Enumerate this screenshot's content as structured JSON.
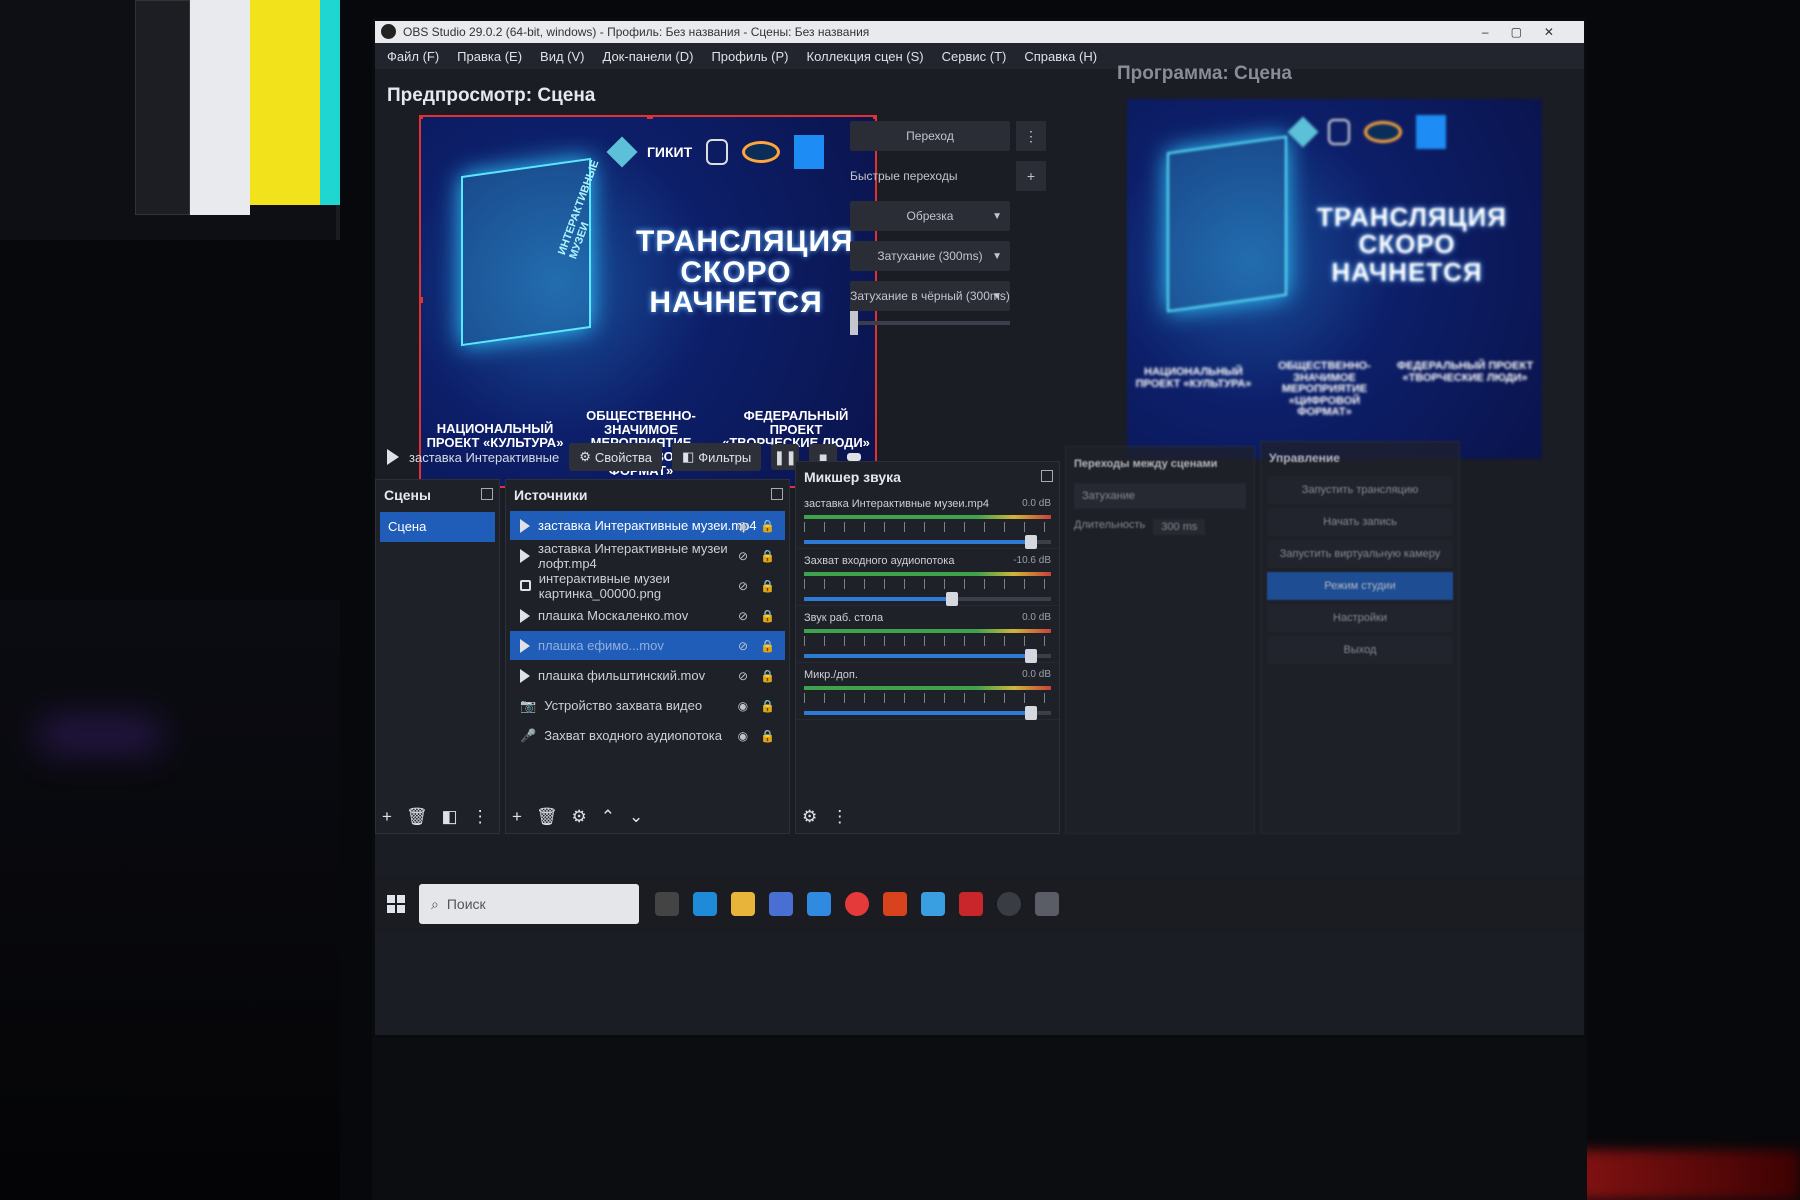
{
  "window": {
    "title": "OBS Studio 29.0.2 (64-bit, windows) - Профиль: Без названия - Сцены: Без названия"
  },
  "menu": [
    "Файл (F)",
    "Правка (E)",
    "Вид (V)",
    "Док-панели (D)",
    "Профиль (P)",
    "Коллекция сцен (S)",
    "Сервис (T)",
    "Справка (H)"
  ],
  "preview": {
    "label": "Предпросмотр: Сцена",
    "logo_text": "ГИКИТ",
    "headline": [
      "ТРАНСЛЯЦИЯ",
      "СКОРО",
      "НАЧНЕТСЯ"
    ],
    "cube_text": "ИНТЕРАКТИВНЫЕ МУЗЕИ",
    "footer": [
      "НАЦИОНАЛЬНЫЙ ПРОЕКТ «КУЛЬТУРА»",
      "ОБЩЕСТВЕННО-ЗНАЧИМОЕ МЕРОПРИЯТИЕ «ЦИФРОВОЙ ФОРМАТ»",
      "ФЕДЕРАЛЬНЫЙ ПРОЕКТ «ТВОРЧЕСКИЕ ЛЮДИ»"
    ]
  },
  "program": {
    "label": "Программа: Сцена"
  },
  "transition_panel": {
    "transition_button": "Переход",
    "quick_transitions": "Быстрые переходы",
    "options": [
      "Обрезка",
      "Затухание (300ms)",
      "Затухание в чёрный (300ms)"
    ]
  },
  "source_toolbar": {
    "current_source": "заставка Интерактивные",
    "properties": "Свойства",
    "filters": "Фильтры"
  },
  "scenes": {
    "title": "Сцены",
    "items": [
      "Сцена"
    ]
  },
  "sources": {
    "title": "Источники",
    "items": [
      {
        "name": "заставка Интерактивные музеи.mp4",
        "type": "media",
        "selected": true
      },
      {
        "name": "заставка Интерактивные музеи лофт.mp4",
        "type": "media",
        "selected": false
      },
      {
        "name": "интерактивные музеи картинка_00000.png",
        "type": "image",
        "selected": false
      },
      {
        "name": "плашка Москаленко.mov",
        "type": "media",
        "selected": false
      },
      {
        "name": "плашка ефимо...mov",
        "type": "media",
        "selected": true
      },
      {
        "name": "плашка фильштинский.mov",
        "type": "media",
        "selected": false
      },
      {
        "name": "Устройство захвата видео",
        "type": "camera",
        "selected": false
      },
      {
        "name": "Захват входного аудиопотока",
        "type": "mic",
        "selected": false
      }
    ]
  },
  "mixer": {
    "title": "Микшер звука",
    "channels": [
      {
        "name": "заставка Интерактивные музеи.mp4",
        "db": "0.0 dB",
        "level": 0.92
      },
      {
        "name": "Захват входного аудиопотока",
        "db": "-10.6 dB",
        "level": 0.6
      },
      {
        "name": "Звук раб. стола",
        "db": "0.0 dB",
        "level": 0.92
      },
      {
        "name": "Микр./доп.",
        "db": "0.0 dB",
        "level": 0.92
      }
    ]
  },
  "transitions_dock": {
    "title": "Переходы между сценами",
    "selected": "Затухание",
    "duration_label": "Длительность",
    "duration": "300 ms"
  },
  "controls_dock": {
    "title": "Управление",
    "buttons": [
      "Запустить трансляцию",
      "Начать запись",
      "Запустить виртуальную камеру",
      "Режим студии",
      "Настройки",
      "Выход"
    ],
    "active_index": 3
  },
  "taskbar": {
    "search_placeholder": "Поиск"
  },
  "colors": {
    "accent": "#1f5db8",
    "selection_red": "#e03232",
    "bg": "#1b1d24"
  }
}
